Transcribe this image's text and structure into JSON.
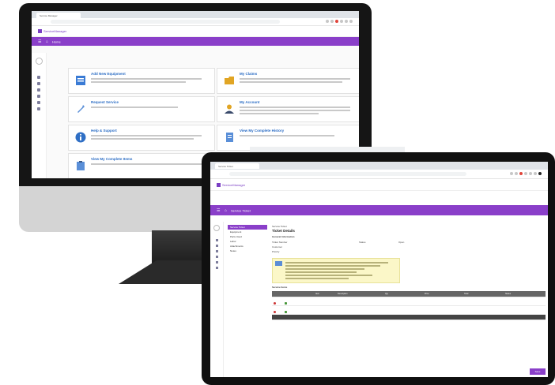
{
  "colors": {
    "purple": "#8a3fc9",
    "link": "#2a6cc4",
    "note_bg": "#fbf7c8"
  },
  "monitor": {
    "browser": {
      "tab_label": "Service Manager",
      "url": ""
    },
    "app_name": "ServiceManager",
    "breadcrumb": "Home",
    "cards": [
      {
        "title": "Add New Equipment",
        "icon": "equipment-form-icon",
        "color": "#3a7bd5"
      },
      {
        "title": "My Claims",
        "icon": "folder-icon",
        "color": "#e1a524"
      },
      {
        "title": "Request Service",
        "icon": "wrench-icon",
        "color": "#5a8fd8"
      },
      {
        "title": "My Account",
        "icon": "user-icon",
        "color": "#3a4a6b"
      },
      {
        "title": "Help & Support",
        "icon": "info-icon",
        "color": "#2f6fc5"
      },
      {
        "title": "View My Complete History",
        "icon": "document-icon",
        "color": "#5a8fd8"
      },
      {
        "title": "View My Complete Items",
        "icon": "clipboard-icon",
        "color": "#5a8fd8"
      }
    ]
  },
  "laptop": {
    "browser": {
      "tab_label": "Service Ticket",
      "url": ""
    },
    "app_name": "ServiceManager",
    "breadcrumb": "Service Ticket",
    "nav": [
      "Service Ticket",
      "Equipment",
      "Parts Used",
      "Labor",
      "Attachments",
      "Notes"
    ],
    "header": {
      "small": "Service Ticket",
      "title": "Ticket Details"
    },
    "section": "General Information",
    "fields": [
      {
        "label": "Ticket Number",
        "value": ""
      },
      {
        "label": "Status",
        "value": "Open"
      },
      {
        "label": "Customer",
        "value": ""
      },
      {
        "label": "Priority",
        "value": ""
      }
    ],
    "table_title": "Service Items",
    "table_headers": [
      "",
      "",
      "Item",
      "Description",
      "Qty",
      "Price",
      "Total",
      "Status"
    ],
    "submit_label": "Save"
  }
}
